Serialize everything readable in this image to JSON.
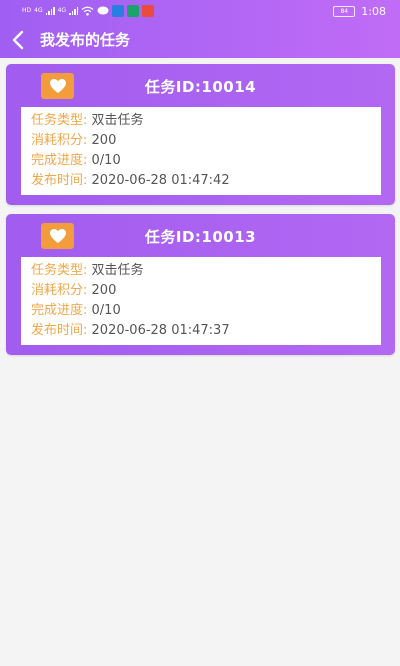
{
  "status_bar": {
    "signal_labels": [
      "HD",
      "4G",
      "4G"
    ],
    "battery": "84",
    "time": "1:08",
    "app_badge_colors": [
      "#2a7de1",
      "#1aa36a",
      "#e94b3c"
    ]
  },
  "header": {
    "title": "我发布的任务"
  },
  "colors": {
    "header_start": "#a05ff2",
    "header_end": "#c06cf6",
    "card": "#a15cf0",
    "label": "#f0a84a",
    "badge": "#f39c3b",
    "value": "#555555"
  },
  "tasks": [
    {
      "title": "任务ID:10014",
      "type_label": "任务类型:",
      "type_value": "双击任务",
      "points_label": "消耗积分:",
      "points_value": "200",
      "progress_label": "完成进度:",
      "progress_value": "0/10",
      "time_label": "发布时间:",
      "time_value": "2020-06-28 01:47:42"
    },
    {
      "title": "任务ID:10013",
      "type_label": "任务类型:",
      "type_value": "双击任务",
      "points_label": "消耗积分:",
      "points_value": "200",
      "progress_label": "完成进度:",
      "progress_value": "0/10",
      "time_label": "发布时间:",
      "time_value": "2020-06-28 01:47:37"
    }
  ]
}
